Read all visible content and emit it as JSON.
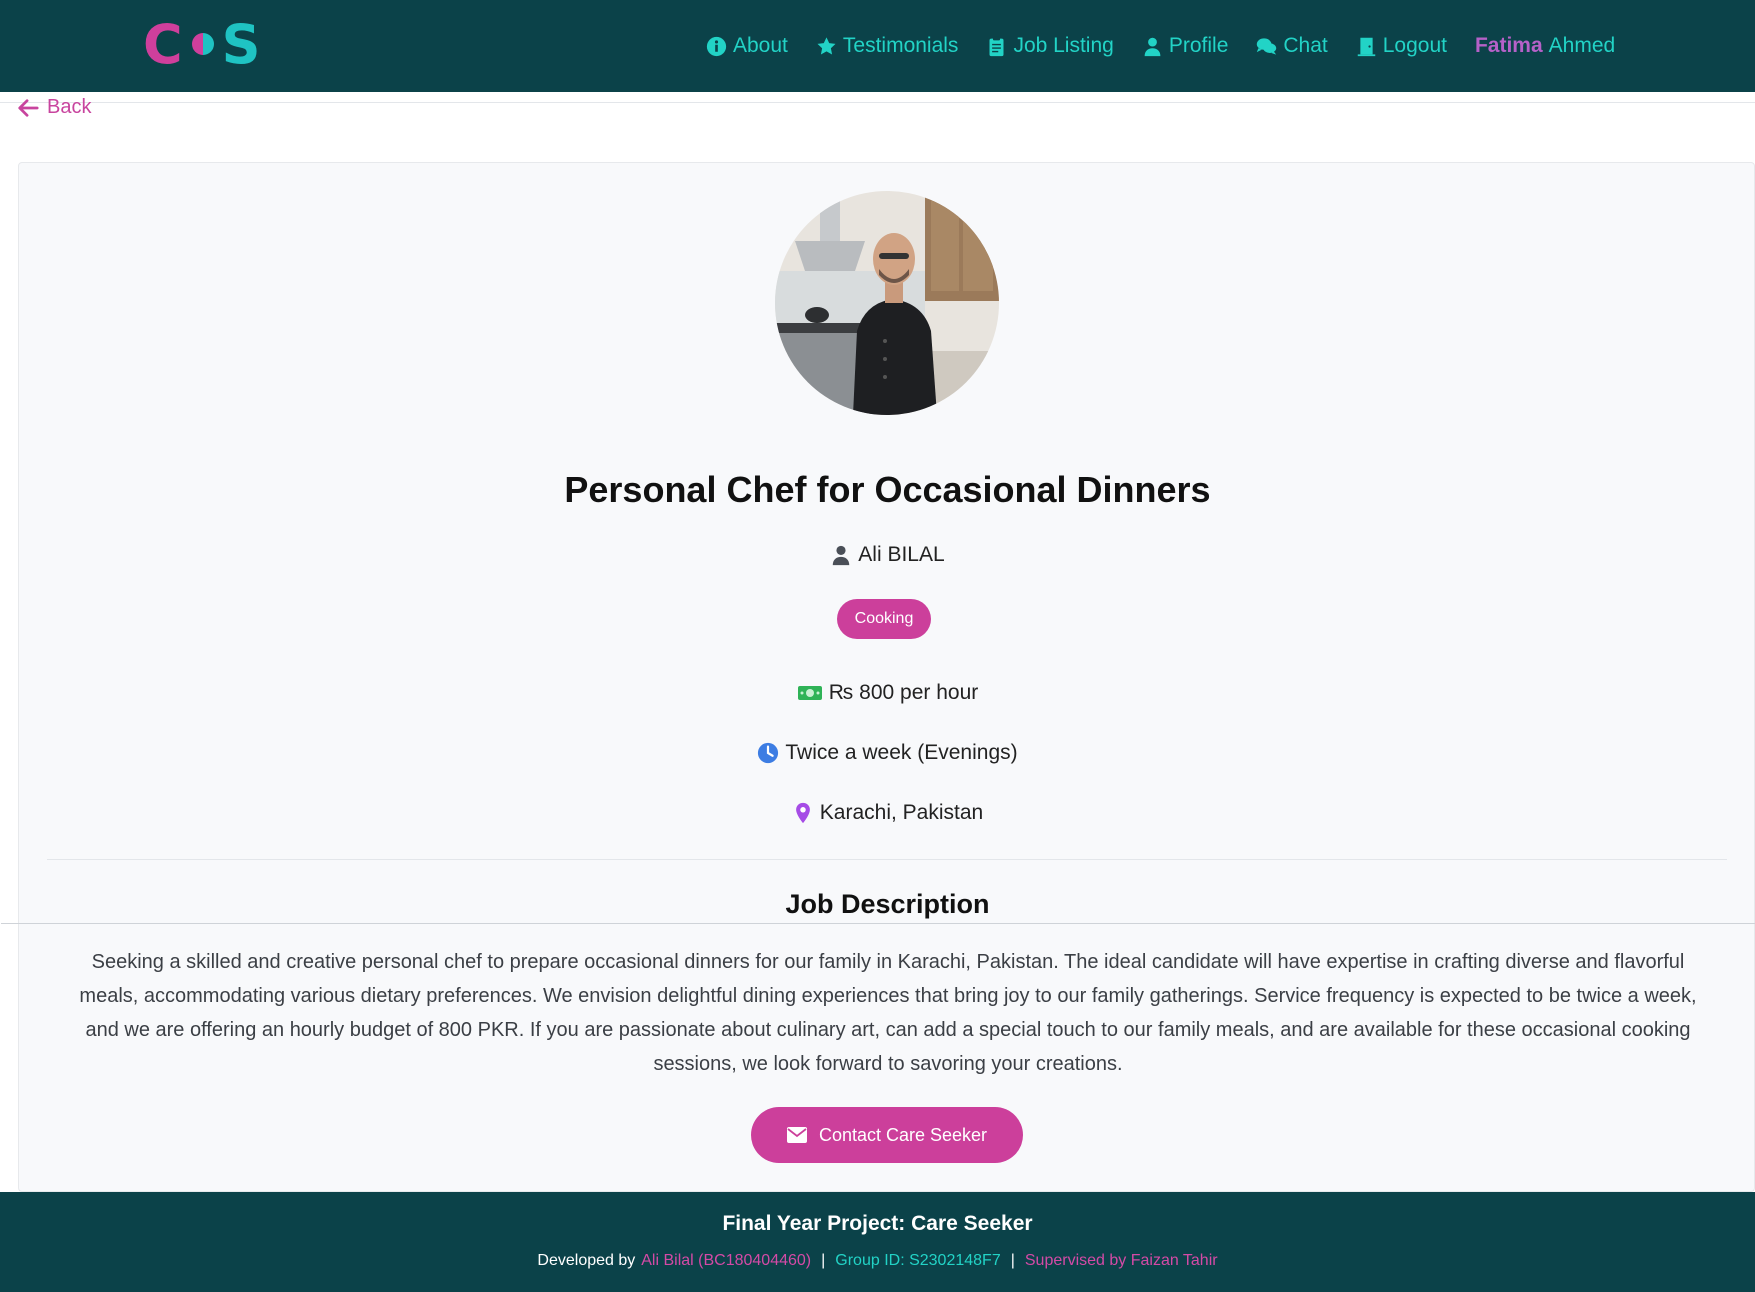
{
  "brand": {
    "logo_left": "C",
    "logo_right": "S",
    "colors": {
      "pink": "#cc3f9b",
      "teal": "#22d3c6",
      "dark_teal": "#0b4249"
    }
  },
  "nav": {
    "items": [
      {
        "label": "About",
        "icon": "info-circle-icon"
      },
      {
        "label": "Testimonials",
        "icon": "star-icon"
      },
      {
        "label": "Job Listing",
        "icon": "clipboard-icon"
      },
      {
        "label": "Profile",
        "icon": "user-icon"
      },
      {
        "label": "Chat",
        "icon": "comments-icon"
      },
      {
        "label": "Logout",
        "icon": "door-icon"
      }
    ],
    "user_first": "Fatima",
    "user_last": "Ahmed"
  },
  "back_label": "Back",
  "job": {
    "title": "Personal Chef for Occasional Dinners",
    "poster": "Ali BILAL",
    "category": "Cooking",
    "rate": "800 per hour",
    "currency_symbol": "₨",
    "schedule": "Twice a week (Evenings)",
    "location": "Karachi, Pakistan",
    "description_heading": "Job Description",
    "description": "Seeking a skilled and creative personal chef to prepare occasional dinners for our family in Karachi, Pakistan. The ideal candidate will have expertise in crafting diverse and flavorful meals, accommodating various dietary preferences. We envision delightful dining experiences that bring joy to our family gatherings. Service frequency is expected to be twice a week, and we are offering an hourly budget of 800 PKR. If you are passionate about culinary art, can add a special touch to our family meals, and are available for these occasional cooking sessions, we look forward to savoring your creations.",
    "contact_label": "Contact Care Seeker"
  },
  "footer": {
    "title": "Final Year Project: Care Seeker",
    "developed_by_prefix": "Developed by",
    "developer": "Ali Bilal (BC180404460)",
    "separator": "|",
    "group_id": "Group ID: S2302148F7",
    "supervisor": "Supervised by Faizan Tahir"
  }
}
